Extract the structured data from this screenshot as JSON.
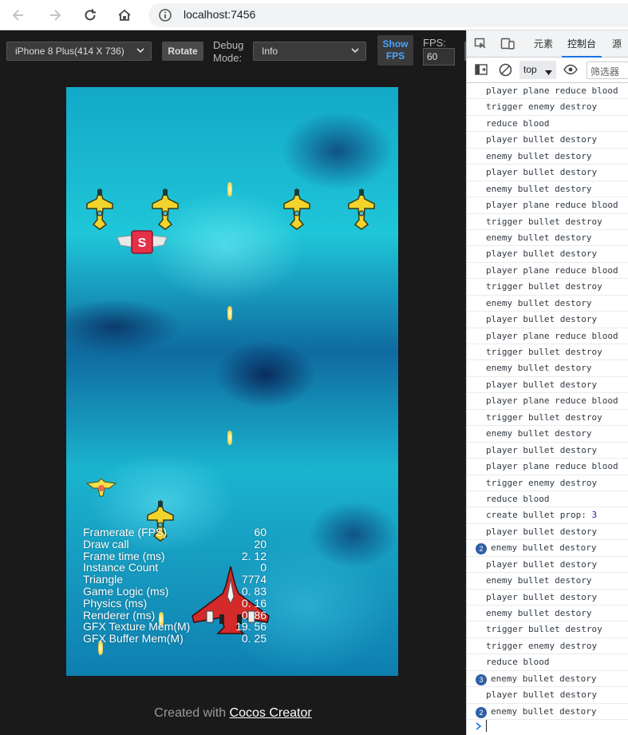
{
  "browser": {
    "url": "localhost:7456"
  },
  "preview_toolbar": {
    "device_select": "iPhone 8 Plus(414 X 736)",
    "rotate_label": "Rotate",
    "debug_mode_label_1": "Debug",
    "debug_mode_label_2": "Mode:",
    "debug_mode_select": "Info",
    "show_fps_line1": "Show",
    "show_fps_line2": "FPS",
    "fps_label": "FPS:",
    "fps_value": "60"
  },
  "stats": [
    {
      "label": "Framerate (FPS)",
      "value": "60"
    },
    {
      "label": "Draw call",
      "value": "20"
    },
    {
      "label": "Frame time (ms)",
      "value": "2. 12"
    },
    {
      "label": "Instance Count",
      "value": "0"
    },
    {
      "label": "Triangle",
      "value": "7774"
    },
    {
      "label": "Game Logic (ms)",
      "value": "0. 83"
    },
    {
      "label": "Physics (ms)",
      "value": "0. 16"
    },
    {
      "label": "Renderer (ms)",
      "value": "0. 86"
    },
    {
      "label": "GFX Texture Mem(M)",
      "value": "19. 56"
    },
    {
      "label": "GFX Buffer Mem(M)",
      "value": "0. 25"
    }
  ],
  "footer": {
    "prefix": "Created with ",
    "link": "Cocos Creator"
  },
  "powerup_letter": "S",
  "devtools": {
    "tabs": [
      "元素",
      "控制台",
      "源代"
    ],
    "active_tab": "控制台",
    "context": "top",
    "filter_placeholder": "筛选器",
    "logs": [
      {
        "text": "player plane reduce blood",
        "count": ""
      },
      {
        "text": "trigger enemy destroy",
        "count": ""
      },
      {
        "text": "reduce blood",
        "count": ""
      },
      {
        "text": "player bullet destory",
        "count": ""
      },
      {
        "text": "enemy bullet destory",
        "count": ""
      },
      {
        "text": "player bullet destory",
        "count": ""
      },
      {
        "text": "enemy bullet destory",
        "count": ""
      },
      {
        "text": "player plane reduce blood",
        "count": ""
      },
      {
        "text": "trigger bullet destroy",
        "count": ""
      },
      {
        "text": "enemy bullet destory",
        "count": ""
      },
      {
        "text": "player bullet destory",
        "count": ""
      },
      {
        "text": "player plane reduce blood",
        "count": ""
      },
      {
        "text": "trigger bullet destroy",
        "count": ""
      },
      {
        "text": "enemy bullet destory",
        "count": ""
      },
      {
        "text": "player bullet destory",
        "count": ""
      },
      {
        "text": "player plane reduce blood",
        "count": ""
      },
      {
        "text": "trigger bullet destroy",
        "count": ""
      },
      {
        "text": "enemy bullet destory",
        "count": ""
      },
      {
        "text": "player bullet destory",
        "count": ""
      },
      {
        "text": "player plane reduce blood",
        "count": ""
      },
      {
        "text": "trigger bullet destroy",
        "count": ""
      },
      {
        "text": "enemy bullet destory",
        "count": ""
      },
      {
        "text": "player bullet destory",
        "count": ""
      },
      {
        "text": "player plane reduce blood",
        "count": ""
      },
      {
        "text": "trigger enemy destroy",
        "count": ""
      },
      {
        "text": "reduce blood",
        "count": ""
      },
      {
        "text": "create bullet prop: ",
        "count": "",
        "num": "3"
      },
      {
        "text": "player bullet destory",
        "count": ""
      },
      {
        "text": "enemy bullet destory",
        "count": "2"
      },
      {
        "text": "player bullet destory",
        "count": ""
      },
      {
        "text": "enemy bullet destory",
        "count": ""
      },
      {
        "text": "player bullet destory",
        "count": ""
      },
      {
        "text": "enemy bullet destory",
        "count": ""
      },
      {
        "text": "trigger bullet destroy",
        "count": ""
      },
      {
        "text": "trigger enemy destroy",
        "count": ""
      },
      {
        "text": "reduce blood",
        "count": ""
      },
      {
        "text": "enemy bullet destory",
        "count": "3"
      },
      {
        "text": "player bullet destory",
        "count": ""
      },
      {
        "text": "enemy bullet destory",
        "count": "2"
      }
    ]
  }
}
